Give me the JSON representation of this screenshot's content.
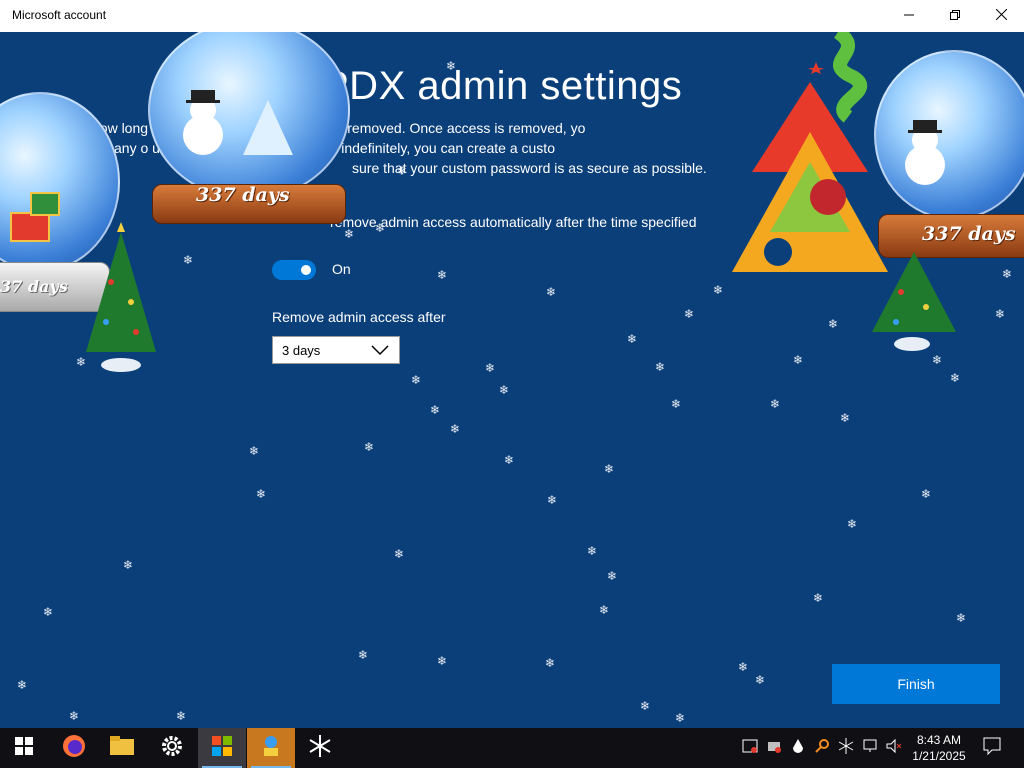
{
  "window": {
    "title": "Microsoft account",
    "minimize_icon": "minimize-icon",
    "maximize_icon": "restore-icon",
    "close_icon": "close-icon"
  },
  "page": {
    "title": "PDX admin settings",
    "description_lines": [
      "how long access to the admin account is removed. Once access is removed, yo",
      "any o u want to retain admin access indefinitely, you can create a custo",
      "sure that your custom password is as secure as possible."
    ],
    "auto_remove_label": "remove admin access automatically after the time specified",
    "toggle": {
      "state": "On",
      "on": true
    },
    "remove_after": {
      "label": "Remove admin access after",
      "selected": "3 days"
    },
    "finish_label": "Finish"
  },
  "decorations": {
    "globe_text": "337 days",
    "globe_text_partial": "37 days",
    "globe_text_partial_right": "337 days"
  },
  "taskbar": {
    "items": [
      {
        "name": "start",
        "icon": "windows-start-icon"
      },
      {
        "name": "firefox",
        "icon": "firefox-icon"
      },
      {
        "name": "file-explorer",
        "icon": "folder-icon"
      },
      {
        "name": "settings",
        "icon": "gear-icon"
      },
      {
        "name": "microsoft-store",
        "icon": "store-icon",
        "active": true
      },
      {
        "name": "app",
        "icon": "app-icon",
        "highlighted": true
      },
      {
        "name": "snowflake-app",
        "icon": "snowflake-icon"
      }
    ],
    "clock": {
      "time": "8:43 AM",
      "date": "1/21/2025"
    }
  },
  "colors": {
    "background": "#0b3f7a",
    "accent": "#0078d7",
    "taskbar": "#101014"
  }
}
